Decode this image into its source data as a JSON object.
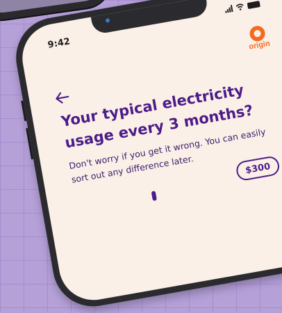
{
  "status_bar": {
    "time": "9:42"
  },
  "brand": {
    "name": "origin",
    "color": "#f36b21"
  },
  "question": {
    "title": "Your typical electricity usage every 3 months?",
    "helper": "Don't worry if you get it wrong. You can easily sort out any difference later."
  },
  "usage_input": {
    "amount_label": "$300"
  },
  "colors": {
    "accent": "#4b1c8a",
    "screen_bg": "#fbf0e7",
    "backdrop": "#b5a0d8"
  },
  "icons": [
    "back-arrow-icon",
    "signal-icon",
    "wifi-icon",
    "battery-icon",
    "origin-logo-icon"
  ]
}
